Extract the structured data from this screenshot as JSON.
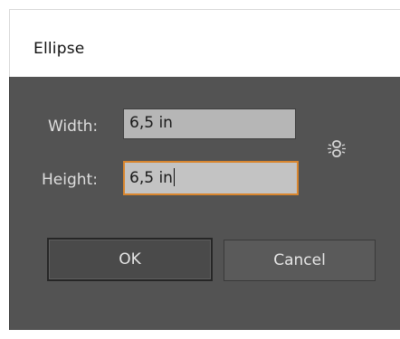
{
  "dialog": {
    "title": "Ellipse"
  },
  "fields": {
    "width": {
      "label": "Width:",
      "value": "6,5 in"
    },
    "height": {
      "label": "Height:",
      "value": "6,5 in"
    }
  },
  "constrain_proportions": {
    "icon": "link-chain-icon",
    "state": "unlinked"
  },
  "buttons": {
    "ok_label": "OK",
    "cancel_label": "Cancel"
  },
  "colors": {
    "dialog_background": "#535353",
    "focus_border": "#d9862e",
    "input_background": "#b6b6b6"
  }
}
